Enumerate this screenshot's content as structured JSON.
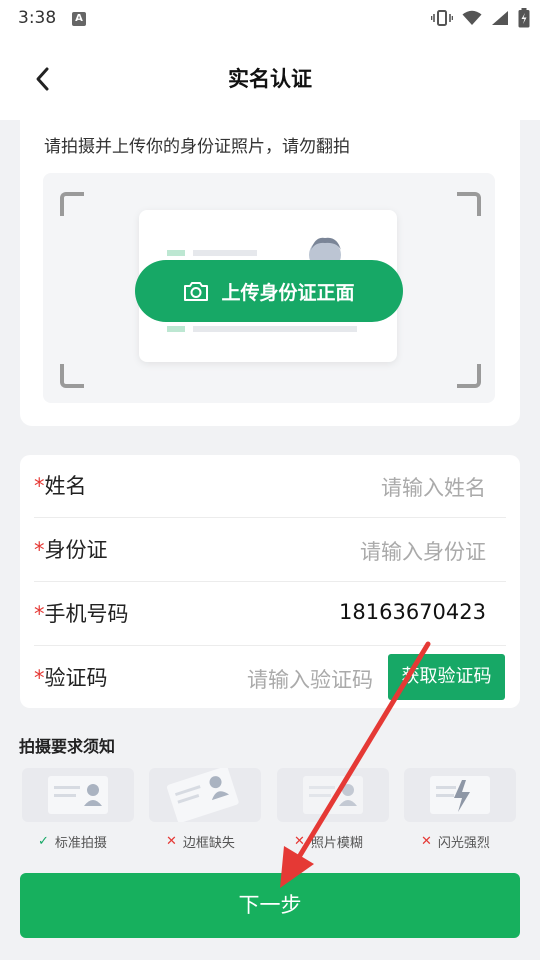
{
  "status_bar": {
    "time": "3:38",
    "badge": "A"
  },
  "header": {
    "title": "实名认证"
  },
  "upload": {
    "hint": "请拍摄并上传你的身份证照片，请勿翻拍",
    "button_label": "上传身份证正面"
  },
  "form": {
    "fields": [
      {
        "star": "*",
        "label": "姓名",
        "placeholder": "请输入姓名",
        "value": ""
      },
      {
        "star": "*",
        "label": "身份证",
        "placeholder": "请输入身份证",
        "value": ""
      },
      {
        "star": "*",
        "label": "手机号码",
        "placeholder": "",
        "value": "18163670423"
      },
      {
        "star": "*",
        "label": "验证码",
        "placeholder": "请输入验证码",
        "value": ""
      }
    ],
    "get_code_label": "获取验证码"
  },
  "requirements": {
    "title": "拍摄要求须知",
    "items": [
      {
        "label": "标准拍摄",
        "mark": "✓",
        "status": "ok"
      },
      {
        "label": "边框缺失",
        "mark": "✕",
        "status": "bad"
      },
      {
        "label": "照片模糊",
        "mark": "✕",
        "status": "bad"
      },
      {
        "label": "闪光强烈",
        "mark": "✕",
        "status": "bad"
      }
    ]
  },
  "next_label": "下一步",
  "colors": {
    "accent": "#17a866",
    "required": "#e53935",
    "annotation_arrow": "#e53935"
  }
}
